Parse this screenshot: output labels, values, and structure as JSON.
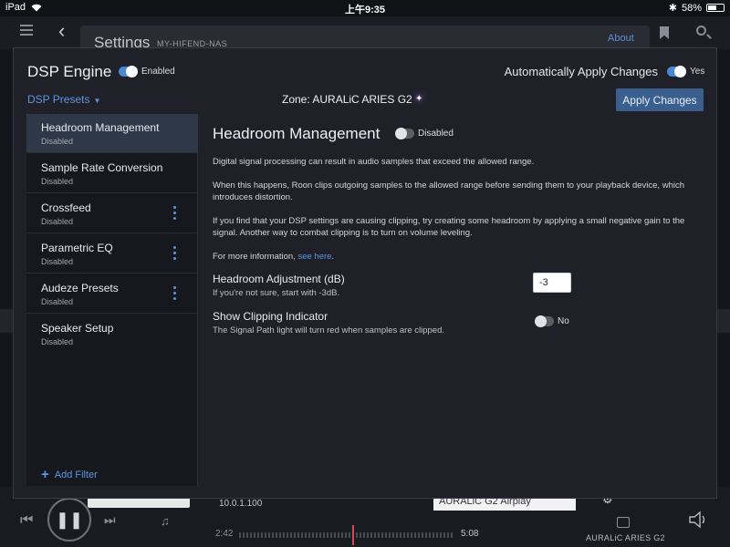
{
  "status_bar": {
    "device": "iPad",
    "time": "上午9:35",
    "battery": "58%",
    "battery_level": 0.58
  },
  "background": {
    "settings_title": "Settings",
    "settings_subtitle": "MY-HIFEND-NAS",
    "about_link": "About"
  },
  "player": {
    "ip": "10.0.1.100",
    "device_select": "AURALiC G2 Airplay",
    "elapsed": "2:42",
    "duration": "5:08",
    "zone": "AURALiC ARIES G2"
  },
  "dialog": {
    "title": "DSP Engine",
    "enabled_label": "Enabled",
    "enabled": true,
    "auto_apply_label": "Automatically Apply Changes",
    "auto_apply_value": "Yes",
    "auto_apply": true,
    "presets_label": "DSP Presets",
    "zone_label": "Zone: AURALiC ARIES G2",
    "apply_button": "Apply Changes",
    "accent_color": "#4a87d4"
  },
  "filters": [
    {
      "name": "Headroom Management",
      "status": "Disabled",
      "active": true,
      "has_menu": false
    },
    {
      "name": "Sample Rate Conversion",
      "status": "Disabled",
      "active": false,
      "has_menu": false
    },
    {
      "name": "Crossfeed",
      "status": "Disabled",
      "active": false,
      "has_menu": true
    },
    {
      "name": "Parametric EQ",
      "status": "Disabled",
      "active": false,
      "has_menu": true
    },
    {
      "name": "Audeze Presets",
      "status": "Disabled",
      "active": false,
      "has_menu": true
    },
    {
      "name": "Speaker Setup",
      "status": "Disabled",
      "active": false,
      "has_menu": false
    }
  ],
  "add_filter_label": "Add Filter",
  "content": {
    "title": "Headroom Management",
    "toggle_label": "Disabled",
    "enabled": false,
    "p1": "Digital signal processing can result in audio samples that exceed the allowed range.",
    "p2": "When this happens, Roon clips outgoing samples to the allowed range before sending them to your playback device, which introduces distortion.",
    "p3": "If you find that your DSP settings are causing clipping, try creating some headroom by applying a small negative gain to the signal. Another way to combat clipping is to turn on volume leveling.",
    "p4_prefix": "For more information, ",
    "p4_link": "see here",
    "p4_suffix": ".",
    "headroom_label": "Headroom Adjustment (dB)",
    "headroom_hint": "If you're not sure, start with -3dB.",
    "headroom_value": "-3",
    "clipping_label": "Show Clipping Indicator",
    "clipping_hint": "The Signal Path light will turn red when samples are clipped.",
    "clipping_value": "No",
    "clipping_enabled": false
  }
}
